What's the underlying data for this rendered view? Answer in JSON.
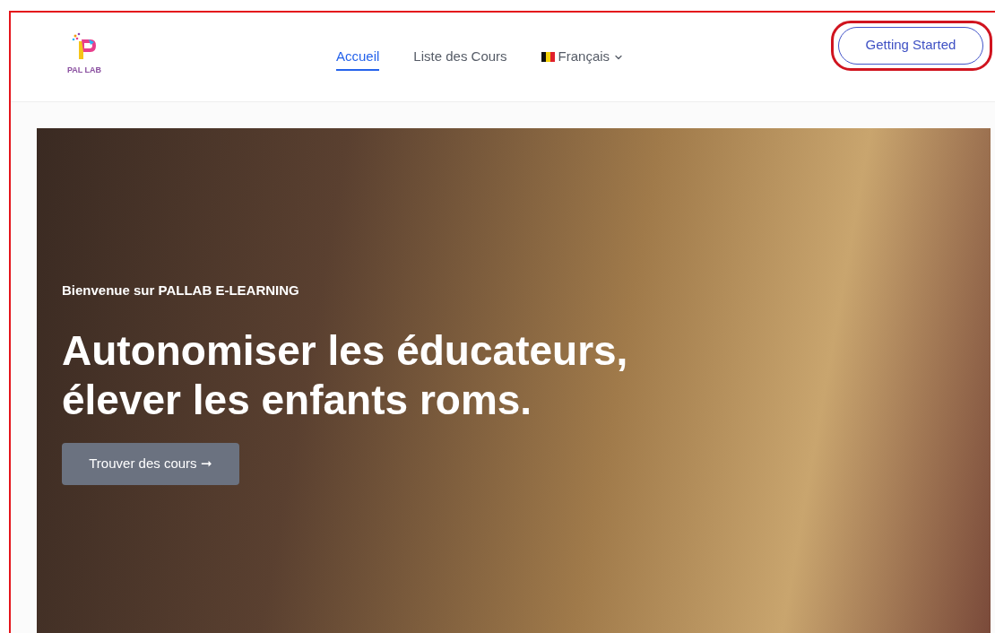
{
  "header": {
    "logo_text": "PAL LAB",
    "nav": [
      {
        "label": "Accueil",
        "selected": true
      },
      {
        "label": "Liste des Cours",
        "selected": false
      }
    ],
    "language": "Français",
    "cta": "Getting Started"
  },
  "hero": {
    "eyebrow": "Bienvenue sur PALLAB E-LEARNING",
    "headline_lines": [
      "Autonomiser les éducateurs,",
      "élever les enfants roms."
    ],
    "button": "Trouver des cours ➞"
  }
}
